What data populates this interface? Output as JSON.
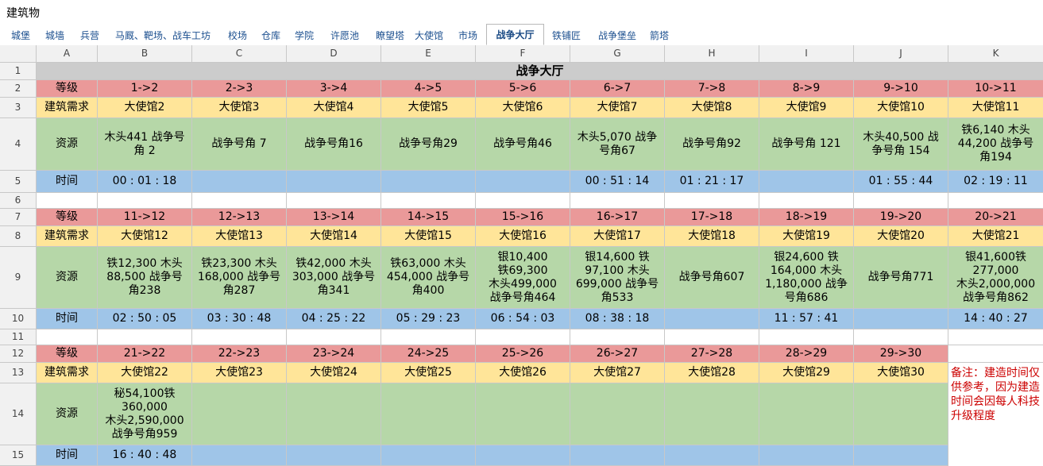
{
  "window": {
    "title": "建筑物"
  },
  "tabs": [
    {
      "label": "城堡",
      "active": false
    },
    {
      "label": "城墙",
      "active": false
    },
    {
      "label": "兵营",
      "active": false
    },
    {
      "label": "马厩、靶场、战车工坊",
      "active": false
    },
    {
      "label": "校场",
      "active": false
    },
    {
      "label": "仓库",
      "active": false
    },
    {
      "label": "学院",
      "active": false
    },
    {
      "label": "许愿池",
      "active": false
    },
    {
      "label": "瞭望塔",
      "active": false
    },
    {
      "label": "大使馆",
      "active": false
    },
    {
      "label": "市场",
      "active": false
    },
    {
      "label": "战争大厅",
      "active": true
    },
    {
      "label": "铁铺匠",
      "active": false
    },
    {
      "label": "战争堡垒",
      "active": false
    },
    {
      "label": "箭塔",
      "active": false
    }
  ],
  "columns": [
    "A",
    "B",
    "C",
    "D",
    "E",
    "F",
    "G",
    "H",
    "I",
    "J",
    "K"
  ],
  "row_numbers": [
    "1",
    "2",
    "3",
    "4",
    "5",
    "6",
    "7",
    "8",
    "9",
    "10",
    "11",
    "12",
    "13",
    "14",
    "15"
  ],
  "sheet_title": "战争大厅",
  "labels": {
    "level": "等级",
    "requirement": "建筑需求",
    "resources": "资源",
    "time": "时间"
  },
  "blocks": [
    {
      "levels": [
        "1->2",
        "2->3",
        "3->4",
        "4->5",
        "5->6",
        "6->7",
        "7->8",
        "8->9",
        "9->10",
        "10->11"
      ],
      "requirements": [
        "大使馆2",
        "大使馆3",
        "大使馆4",
        "大使馆5",
        "大使馆6",
        "大使馆7",
        "大使馆8",
        "大使馆9",
        "大使馆10",
        "大使馆11"
      ],
      "resources": [
        "木头441 战争号\n角 2",
        "战争号角 7",
        "战争号角16",
        "战争号角29",
        "战争号角46",
        "木头5,070 战争\n号角67",
        "战争号角92",
        "战争号角 121",
        "木头40,500 战\n争号角 154",
        "铁6,140 木头\n44,200 战争号\n角194"
      ],
      "times": [
        "00 : 01 : 18",
        "",
        "",
        "",
        "",
        "00 : 51 : 14",
        "01 : 21 : 17",
        "",
        "01 : 55 : 44",
        "02 : 19 : 11"
      ]
    },
    {
      "levels": [
        "11->12",
        "12->13",
        "13->14",
        "14->15",
        "15->16",
        "16->17",
        "17->18",
        "18->19",
        "19->20",
        "20->21"
      ],
      "requirements": [
        "大使馆12",
        "大使馆13",
        "大使馆14",
        "大使馆15",
        "大使馆16",
        "大使馆17",
        "大使馆18",
        "大使馆19",
        "大使馆20",
        "大使馆21"
      ],
      "resources": [
        "铁12,300 木头\n88,500 战争号\n角238",
        "铁23,300 木头\n168,000 战争号\n角287",
        "铁42,000 木头\n303,000 战争号\n角341",
        "铁63,000 木头\n454,000 战争号\n角400",
        "银10,400\n铁69,300\n木头499,000\n战争号角464",
        "银14,600 铁\n97,100 木头\n699,000 战争号\n角533",
        "战争号角607",
        "银24,600 铁\n164,000 木头\n1,180,000 战争\n号角686",
        "战争号角771",
        "银41,600铁\n277,000\n木头2,000,000\n战争号角862"
      ],
      "times": [
        "02 : 50 : 05",
        "03 : 30 : 48",
        "04 : 25 : 22",
        "05 : 29 : 23",
        "06 : 54 : 03",
        "08 : 38 : 18",
        "",
        "11 : 57 : 41",
        "",
        "14 : 40 : 27"
      ]
    },
    {
      "levels": [
        "21->22",
        "22->23",
        "23->24",
        "24->25",
        "25->26",
        "26->27",
        "27->28",
        "28->29",
        "29->30"
      ],
      "requirements": [
        "大使馆22",
        "大使馆23",
        "大使馆24",
        "大使馆25",
        "大使馆26",
        "大使馆27",
        "大使馆28",
        "大使馆29",
        "大使馆30"
      ],
      "resources": [
        "秘54,100铁\n360,000\n木头2,590,000\n战争号角959",
        "",
        "",
        "",
        "",
        "",
        "",
        "",
        ""
      ],
      "times": [
        "16 : 40 : 48",
        "",
        "",
        "",
        "",
        "",
        "",
        "",
        ""
      ]
    }
  ],
  "note": "备注：建造时间仅供参考，因为建造时间会因每人科技升级程度",
  "colors": {
    "level_row": "#ea9999",
    "requirement_row": "#ffe599",
    "resource_row": "#b6d7a8",
    "time_row": "#9fc5e8",
    "title_row": "#cccccc",
    "note_text": "#cc0000"
  }
}
